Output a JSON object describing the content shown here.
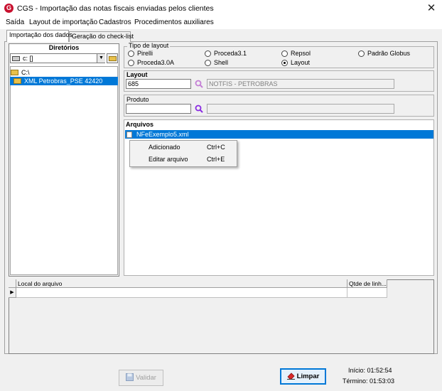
{
  "window": {
    "icon_letter": "G",
    "title": "CGS - Importação das notas fiscais enviadas pelos clientes",
    "close_glyph": "✕"
  },
  "menu": [
    "Saída",
    "Layout de importação",
    "Cadastros",
    "Procedimentos auxiliares"
  ],
  "tabs": [
    {
      "label": "Importação dos dados",
      "active": true
    },
    {
      "label": "Geração do check-list",
      "active": false
    }
  ],
  "directories": {
    "title": "Diretórios",
    "drive": "c: []",
    "tree": [
      "C:\\",
      "XML Petrobras_PSE 42420"
    ],
    "selected_index": 1
  },
  "layout_type": {
    "title": "Tipo de layout",
    "options": [
      "Pirelli",
      "Proceda3.1",
      "Repsol",
      "Padrão Globus",
      "Proceda3.0A",
      "Shell",
      "Layout"
    ],
    "selected": "Layout"
  },
  "layout": {
    "title": "Layout",
    "code": "685",
    "name": "NOTFIS - PETROBRAS"
  },
  "produto": {
    "title": "Produto",
    "code": "",
    "name": ""
  },
  "arquivos": {
    "title": "Arquivos",
    "files": [
      "NFeExemplo5.xml"
    ],
    "context_menu": [
      {
        "label": "Adicionado",
        "shortcut": "Ctrl+C"
      },
      {
        "label": "Editar arquivo",
        "shortcut": "Ctrl+E"
      }
    ]
  },
  "grid": {
    "columns": [
      "Local do arquivo",
      "Qtde de linh..."
    ],
    "row_marker": "▶"
  },
  "buttons": {
    "validar": "Validar",
    "limpar": "Limpar"
  },
  "times": {
    "inicio": "Início: 01:52:54",
    "termino": "Término: 01:53:03"
  },
  "colors": {
    "selection": "#0078d7",
    "brand": "#c8102e",
    "search_icon": "#8a2be2"
  },
  "icons": {
    "search": "search-icon",
    "folder": "folder-icon",
    "drive": "drive-icon",
    "save": "save-icon",
    "eraser": "eraser-icon"
  }
}
